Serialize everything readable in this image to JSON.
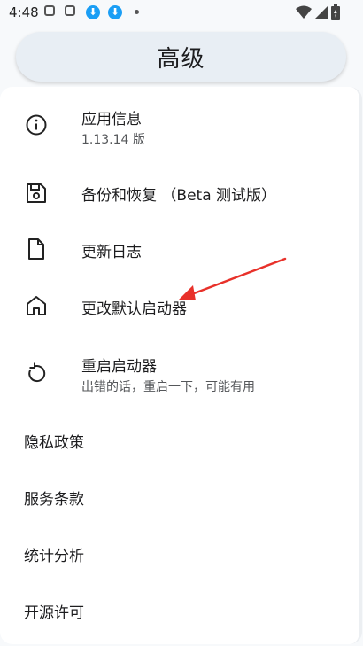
{
  "status_bar": {
    "time": "4:48",
    "icons": [
      "shopping-bag-icon",
      "shopping-bag-icon",
      "download-icon",
      "download-icon",
      "dot-icon"
    ],
    "right_icons": [
      "wifi-icon",
      "cell-signal-icon",
      "battery-charging-icon"
    ]
  },
  "header": {
    "title": "高级"
  },
  "items": [
    {
      "title": "应用信息",
      "subtitle": "1.13.14 版",
      "icon": "info-icon"
    },
    {
      "title": "备份和恢复 （Beta 测试版）",
      "icon": "save-icon"
    },
    {
      "title": "更新日志",
      "icon": "document-icon"
    },
    {
      "title": "更改默认启动器",
      "icon": "home-icon"
    },
    {
      "title": "重启启动器",
      "subtitle": "出错的话，重启一下，可能有用",
      "icon": "restart-icon"
    }
  ],
  "plain_items": [
    {
      "title": "隐私政策"
    },
    {
      "title": "服务条款"
    },
    {
      "title": "统计分析"
    },
    {
      "title": "开源许可"
    }
  ],
  "colors": {
    "accent_arrow": "#e8312a",
    "header_bg": "#e8eef4"
  }
}
